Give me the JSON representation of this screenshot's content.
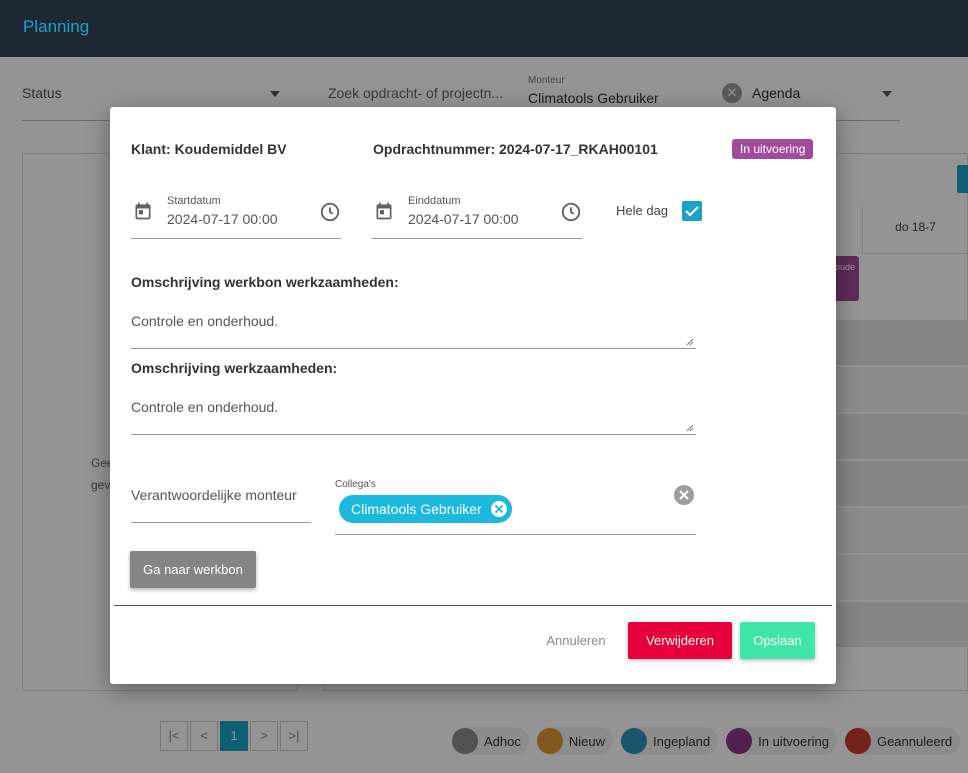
{
  "app": {
    "title": "Planning"
  },
  "filters": {
    "status_label": "Status",
    "search_placeholder": "Zoek opdracht- of projectn...",
    "monteur_label": "Monteur",
    "monteur_value": "Climatools Gebruiker",
    "agenda_value": "Agenda"
  },
  "background": {
    "empty_message": "Gee gev",
    "calendar_header": "do 18-7",
    "event_label": "oude"
  },
  "pagination": {
    "first": "|<",
    "prev": "<",
    "current": "1",
    "next": ">",
    "last": ">|"
  },
  "legend": [
    {
      "label": "Adhoc",
      "color": "#8c8c8c"
    },
    {
      "label": "Nieuw",
      "color": "#e09a2e"
    },
    {
      "label": "Ingepland",
      "color": "#2d95b8"
    },
    {
      "label": "In uitvoering",
      "color": "#8a3a85"
    },
    {
      "label": "Geannuleerd",
      "color": "#c73a30"
    }
  ],
  "modal": {
    "klant_label": "Klant:",
    "klant_value": "Koudemiddel BV",
    "opdracht_label": "Opdrachtnummer:",
    "opdracht_value": "2024-07-17_RKAH00101",
    "status_badge": "In uitvoering",
    "status_color": "#a24b9c",
    "start_label": "Startdatum",
    "start_value": "2024-07-17 00:00",
    "end_label": "Einddatum",
    "end_value": "2024-07-17 00:00",
    "hele_dag_label": "Hele dag",
    "hele_dag_checked": true,
    "werkbon_title": "Omschrijving werkbon werkzaamheden:",
    "werkbon_text": "Controle en onderhoud.",
    "werkzaamheden_title": "Omschrijving werkzaamheden:",
    "werkzaamheden_text": "Controle en onderhoud.",
    "verantwoordelijke_placeholder": "Verantwoordelijke monteur",
    "collegas_label": "Collega's",
    "collegas_chip": "Climatools Gebruiker",
    "btn_werkbon": "Ga naar werkbon",
    "btn_annuleren": "Annuleren",
    "btn_verwijderen": "Verwijderen",
    "btn_opslaan": "Opslaan"
  }
}
